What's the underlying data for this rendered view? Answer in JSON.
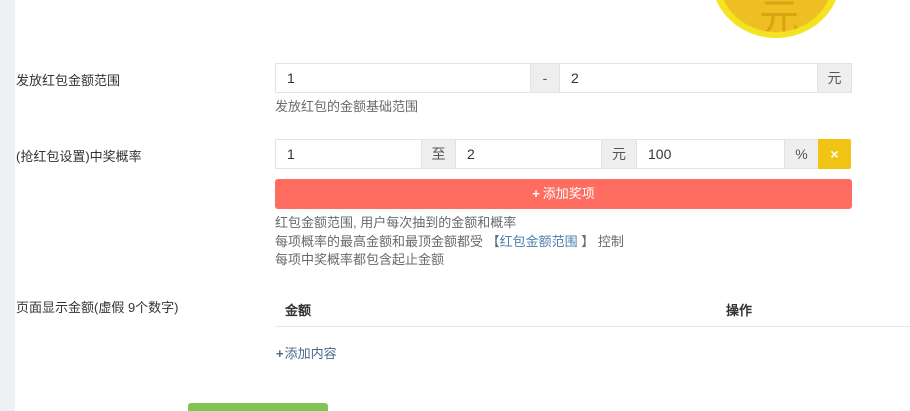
{
  "coin": {
    "glyph": "元"
  },
  "amount_range": {
    "label": "发放红包金额范围",
    "min_value": "1",
    "separator": "-",
    "max_value": "2",
    "unit": "元",
    "hint": "发放红包的金额基础范围"
  },
  "probability": {
    "label": "(抢红包设置)中奖概率",
    "min_value": "1",
    "to_label": "至",
    "max_value": "2",
    "unit": "元",
    "rate_value": "100",
    "percent_label": "%",
    "remove_icon": "×",
    "add_button_icon": "+",
    "add_button_label": "添加奖项",
    "hint_line1": "红包金额范围, 用户每次抽到的金额和概率",
    "hint_line2_prefix": "每项概率的最高金额和最顶金额都受 【",
    "hint_line2_link": "红包金额范围",
    "hint_line2_suffix": " 】 控制",
    "hint_line3": "每项中奖概率都包含起止金额"
  },
  "display_amounts": {
    "label": "页面显示金额(虚假 9个数字)",
    "columns": [
      "金额",
      "操作"
    ],
    "add_icon": "+",
    "add_label": "添加内容"
  },
  "colors": {
    "danger_button": "#ff6c60",
    "warning_button": "#f0c314",
    "submit_button": "#7ec552",
    "link": "#4a7fb0"
  }
}
